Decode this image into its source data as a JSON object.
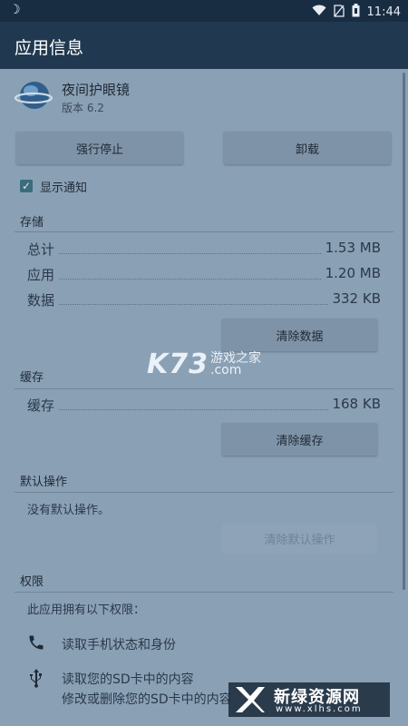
{
  "status": {
    "time": "11:44"
  },
  "header": {
    "title": "应用信息"
  },
  "app": {
    "name": "夜间护眼镜",
    "version": "版本 6.2"
  },
  "actions": {
    "force_stop": "强行停止",
    "uninstall": "卸载"
  },
  "notification": {
    "label": "显示通知",
    "checked": true
  },
  "storage": {
    "title": "存储",
    "rows": [
      {
        "label": "总计",
        "value": "1.53 MB"
      },
      {
        "label": "应用",
        "value": "1.20 MB"
      },
      {
        "label": "数据",
        "value": "332 KB"
      }
    ],
    "clear_data": "清除数据"
  },
  "cache": {
    "title": "缓存",
    "row": {
      "label": "缓存",
      "value": "168 KB"
    },
    "clear_cache": "清除缓存"
  },
  "defaults": {
    "title": "默认操作",
    "text": "没有默认操作。",
    "clear_defaults": "清除默认操作"
  },
  "permissions": {
    "title": "权限",
    "intro": "此应用拥有以下权限：",
    "items": [
      {
        "icon": "phone-icon",
        "text": "读取手机状态和身份"
      },
      {
        "icon": "usb-icon",
        "text": "读取您的SD卡中的内容"
      },
      {
        "icon": "usb-icon",
        "text": "修改或删除您的SD卡中的内容"
      }
    ]
  },
  "watermark": {
    "k73": "K73",
    "cn": "游戏之家",
    "com": ".com"
  },
  "badge": {
    "brand": "新绿资源网",
    "site": "www.xlhs.com"
  },
  "colors": {
    "statusbar": "#182c42",
    "appbar": "#213950",
    "background": "#8aa0b5",
    "button": "#7f93a8",
    "checkbox": "#3b6c7e"
  }
}
